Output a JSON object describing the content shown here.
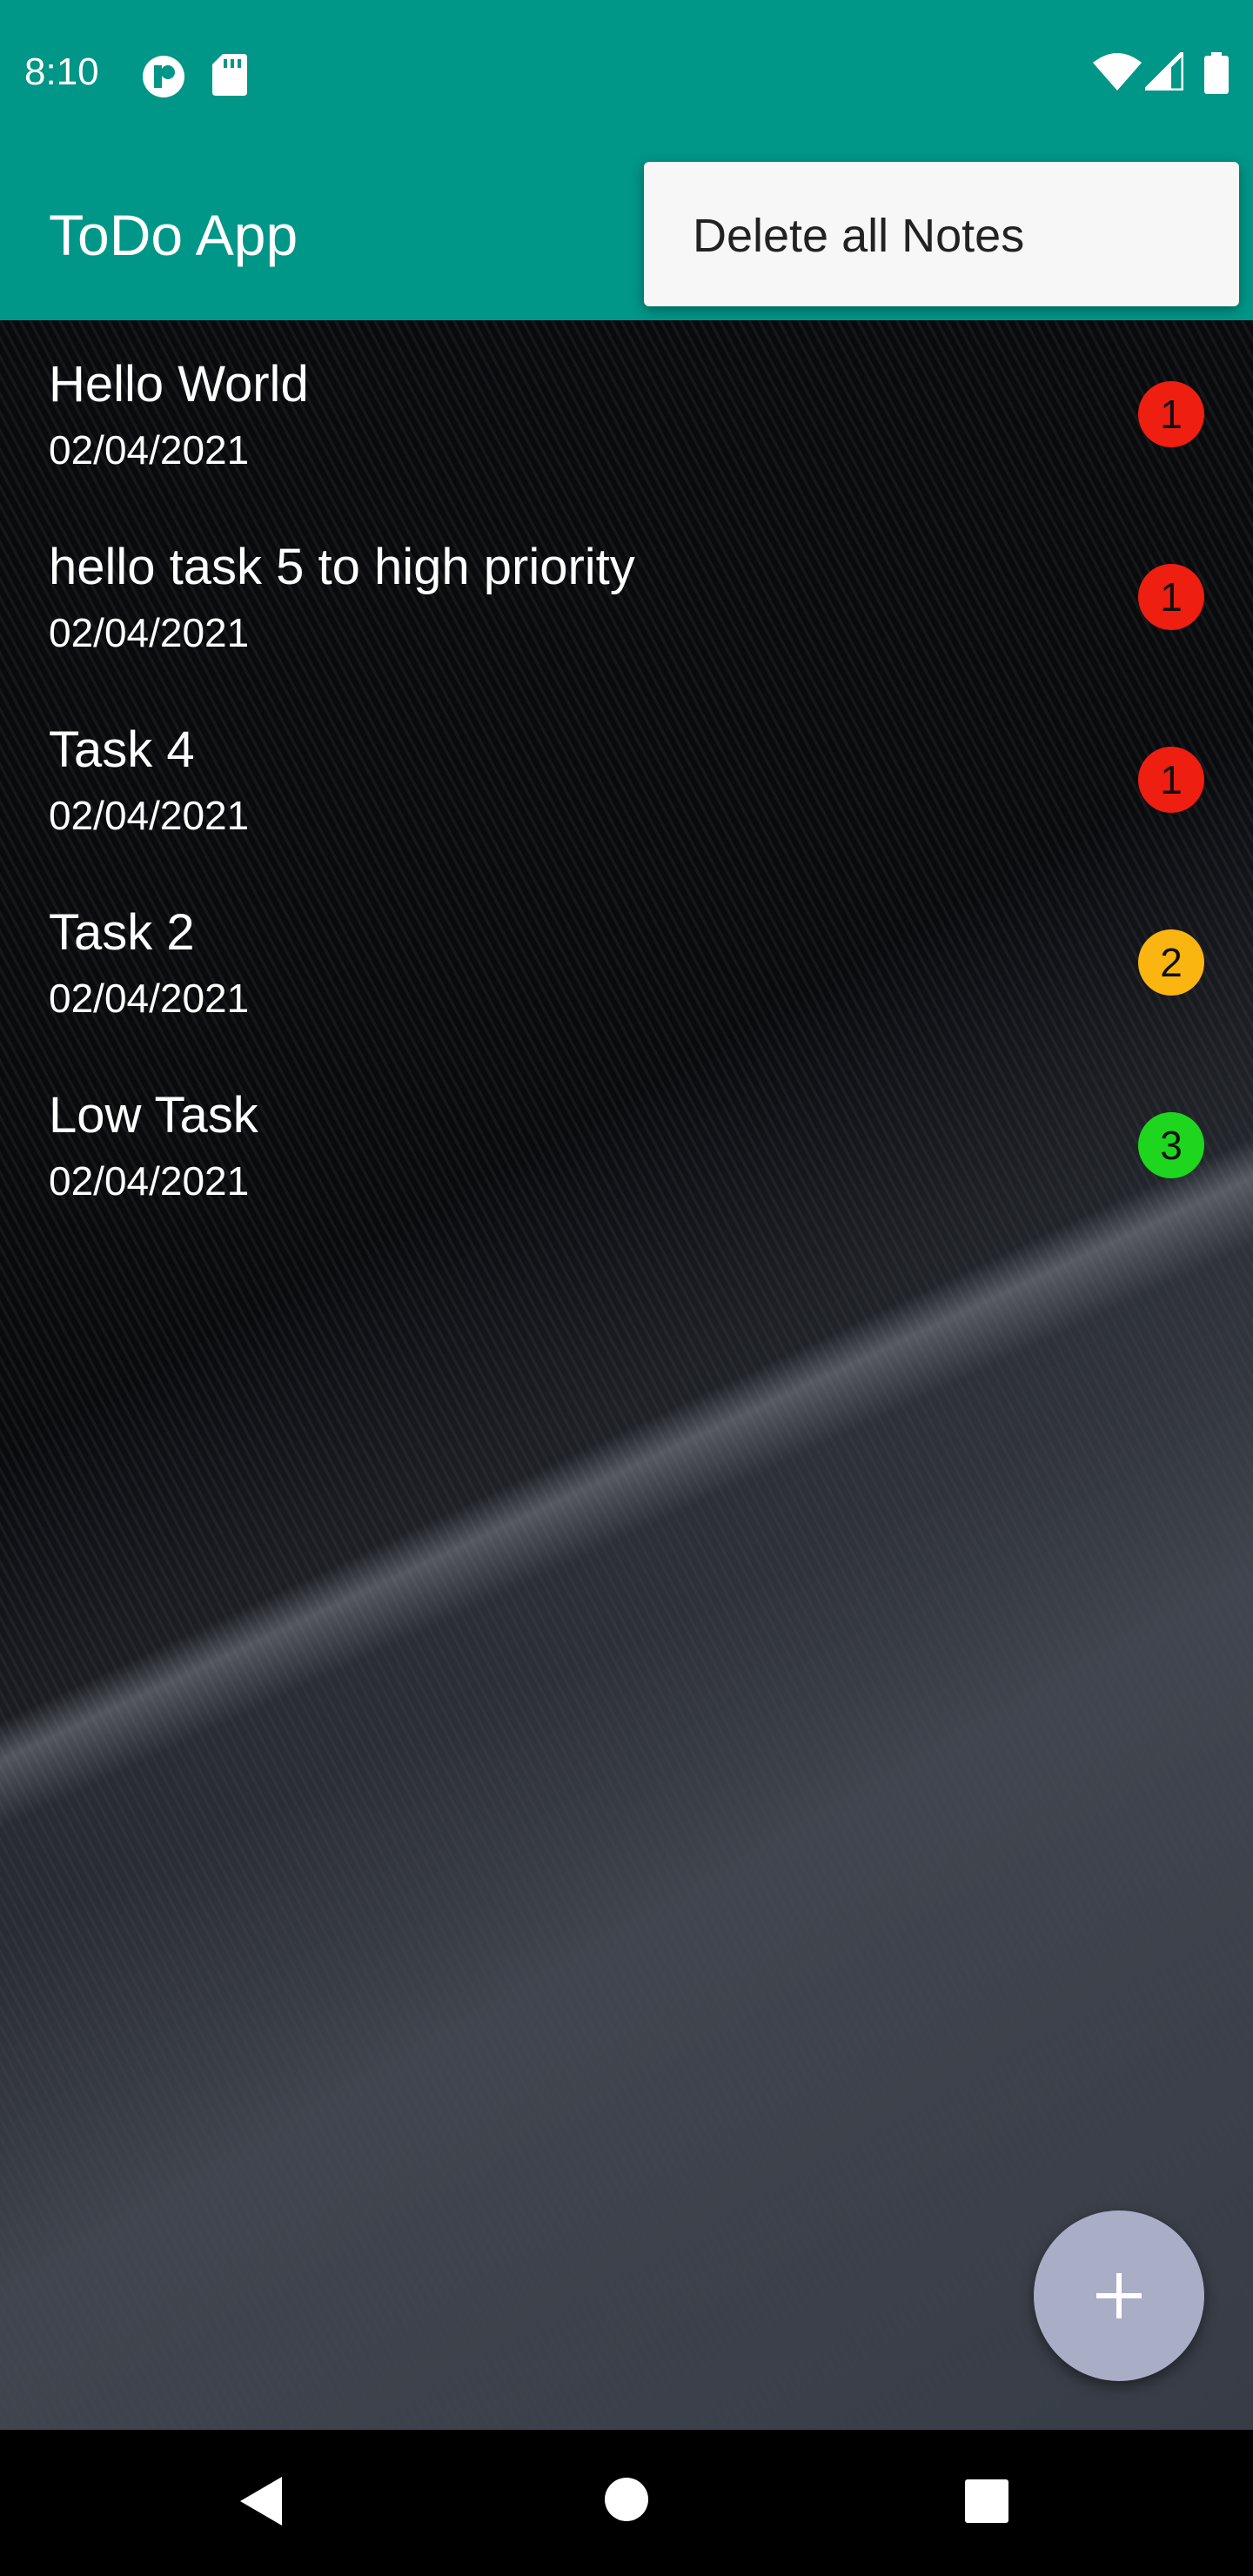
{
  "status_bar": {
    "time": "8:10",
    "icons": [
      "notification-app-icon",
      "sd-card-icon",
      "wifi-icon",
      "signal-icon",
      "battery-icon"
    ]
  },
  "app_bar": {
    "title": "ToDo App",
    "background_color": "#009688"
  },
  "overflow_menu": {
    "items": [
      {
        "label": "Delete all Notes"
      }
    ]
  },
  "tasks": [
    {
      "title": "Hello World",
      "date": "02/04/2021",
      "priority": "1",
      "priority_color": "#ee1e10"
    },
    {
      "title": "hello task 5 to high priority",
      "date": "02/04/2021",
      "priority": "1",
      "priority_color": "#ee1e10"
    },
    {
      "title": "Task 4",
      "date": "02/04/2021",
      "priority": "1",
      "priority_color": "#ee1e10"
    },
    {
      "title": "Task 2",
      "date": "02/04/2021",
      "priority": "2",
      "priority_color": "#fbb511"
    },
    {
      "title": "Low Task",
      "date": "02/04/2021",
      "priority": "3",
      "priority_color": "#1ed61e"
    }
  ],
  "fab": {
    "icon": "plus-icon",
    "color": "#a9aec6"
  },
  "nav_bar": {
    "icons": [
      "back-icon",
      "home-icon",
      "recents-icon"
    ]
  }
}
